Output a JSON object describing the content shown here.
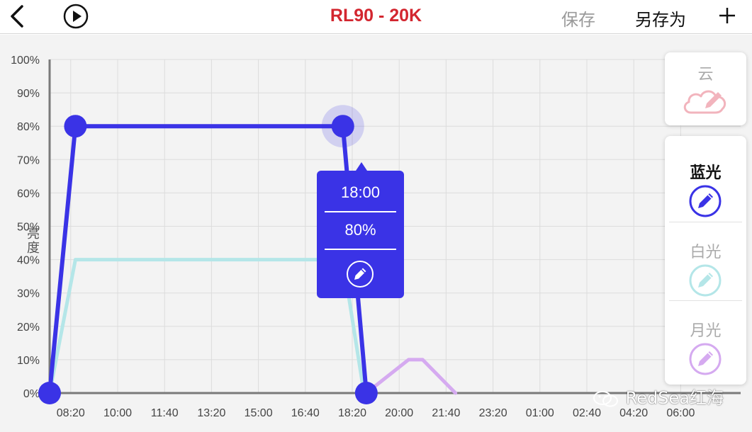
{
  "header": {
    "title": "RL90 - 20K",
    "save_label": "保存",
    "save_as_label": "另存为",
    "icons": {
      "back": "chevron-left-icon",
      "play": "play-icon",
      "add": "plus-icon"
    }
  },
  "chart_data": {
    "type": "line",
    "ylabel": "亮度",
    "y_ticks": [
      "100%",
      "90%",
      "80%",
      "70%",
      "60%",
      "50%",
      "40%",
      "30%",
      "20%",
      "10%",
      "0%"
    ],
    "x_ticks": [
      "08:20",
      "10:00",
      "11:40",
      "13:20",
      "15:00",
      "16:40",
      "18:20",
      "20:00",
      "21:40",
      "23:20",
      "01:00",
      "02:40",
      "04:20",
      "06:00"
    ],
    "ylim": [
      0,
      100
    ],
    "grid": true,
    "series": [
      {
        "name": "蓝光",
        "color": "#3a33e6",
        "points": [
          [
            "07:35",
            0
          ],
          [
            "08:30",
            80
          ],
          [
            "18:00",
            80
          ],
          [
            "18:50",
            0
          ]
        ]
      },
      {
        "name": "白光",
        "color": "#b4e6e8",
        "points": [
          [
            "07:35",
            0
          ],
          [
            "08:30",
            40
          ],
          [
            "18:00",
            40
          ],
          [
            "18:45",
            0
          ]
        ]
      },
      {
        "name": "月光",
        "color": "#d5aaf0",
        "points": [
          [
            "18:50",
            0
          ],
          [
            "20:20",
            10
          ],
          [
            "20:50",
            10
          ],
          [
            "22:00",
            0
          ]
        ]
      }
    ]
  },
  "tooltip": {
    "time": "18:00",
    "value": "80%",
    "icon": "pencil-icon"
  },
  "cloud": {
    "label": "云",
    "color": "#f2b4bd",
    "icon": "cloud-edit-icon"
  },
  "channels": [
    {
      "label": "蓝光",
      "color": "#3a33e6",
      "text_color": "#111111",
      "active": true,
      "icon": "pencil-circle-icon"
    },
    {
      "label": "白光",
      "color": "#b4e6e8",
      "text_color": "#aaaaaa",
      "active": false,
      "icon": "pencil-circle-icon"
    },
    {
      "label": "月光",
      "color": "#d5aaf0",
      "text_color": "#aaaaaa",
      "active": false,
      "icon": "pencil-circle-icon"
    }
  ],
  "watermark": {
    "text": "RedSea红海",
    "icon": "wechat-icon"
  }
}
